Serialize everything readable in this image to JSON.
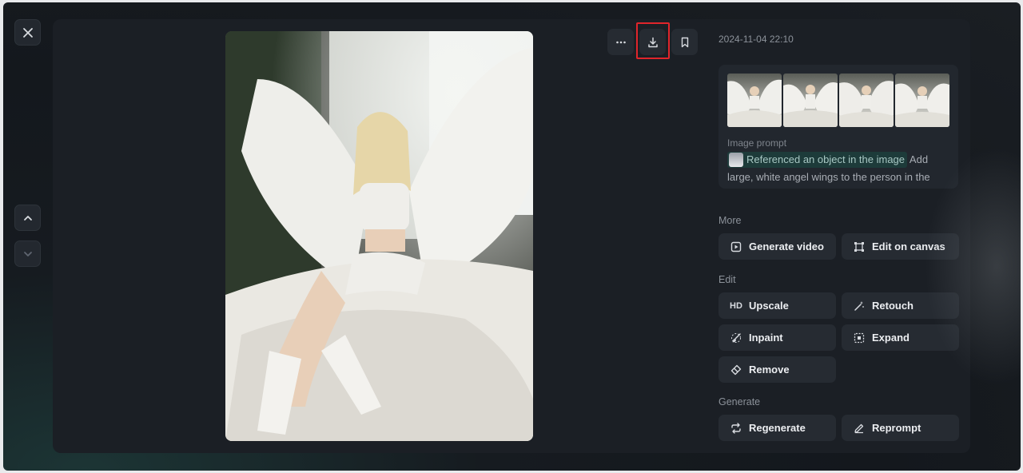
{
  "viewer": {
    "timestamp": "2024-11-04 22:10",
    "prompt": {
      "label": "Image prompt",
      "reference_chip": "Referenced an object in the image",
      "text": "Add large, white angel wings to the person in the photo, with"
    }
  },
  "sections": {
    "more": {
      "title": "More",
      "generate_video": "Generate video",
      "edit_on_canvas": "Edit on canvas"
    },
    "edit": {
      "title": "Edit",
      "upscale_badge": "HD",
      "upscale": "Upscale",
      "retouch": "Retouch",
      "inpaint": "Inpaint",
      "expand": "Expand",
      "remove": "Remove"
    },
    "generate": {
      "title": "Generate",
      "regenerate": "Regenerate",
      "reprompt": "Reprompt"
    }
  },
  "colors": {
    "accent_highlight": "#e0252b",
    "panel_bg": "#1b1f25",
    "button_bg": "#262b32"
  },
  "icons": {
    "close": "close-icon",
    "up": "chevron-up-icon",
    "down": "chevron-down-icon",
    "more": "ellipsis-icon",
    "download": "download-icon",
    "bookmark": "bookmark-icon"
  }
}
